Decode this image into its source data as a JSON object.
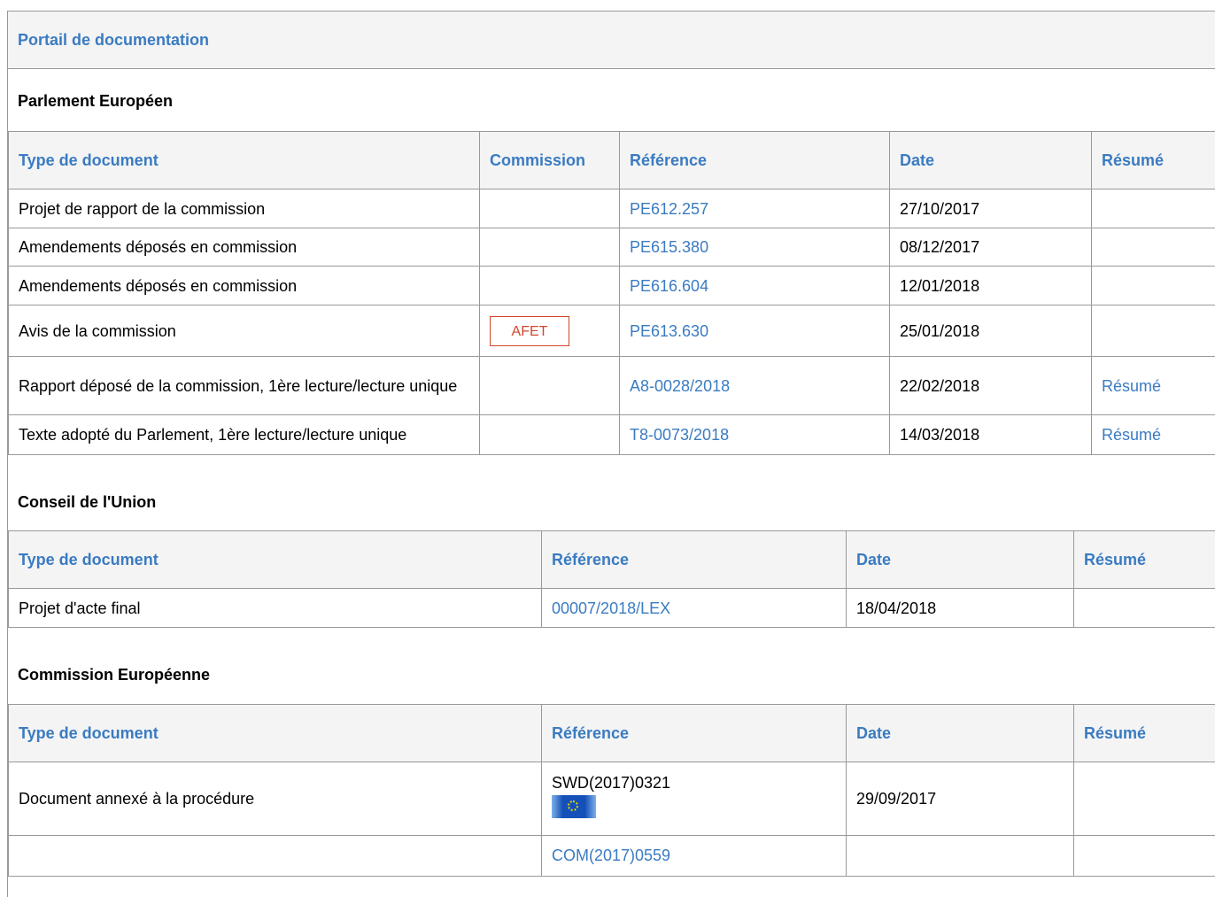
{
  "portal": {
    "title": "Portail de documentation"
  },
  "parlement": {
    "title": "Parlement Européen",
    "headers": {
      "type": "Type de document",
      "commission": "Commission",
      "reference": "Référence",
      "date": "Date",
      "resume": "Résumé"
    },
    "rows": [
      {
        "type": "Projet de rapport de la commission",
        "commission": "",
        "reference": "PE612.257",
        "date": "27/10/2017",
        "resume": ""
      },
      {
        "type": "Amendements déposés en commission",
        "commission": "",
        "reference": "PE615.380",
        "date": "08/12/2017",
        "resume": ""
      },
      {
        "type": "Amendements déposés en commission",
        "commission": "",
        "reference": "PE616.604",
        "date": "12/01/2018",
        "resume": ""
      },
      {
        "type": "Avis de la commission",
        "commission": "AFET",
        "reference": "PE613.630",
        "date": "25/01/2018",
        "resume": ""
      },
      {
        "type": "Rapport déposé de la commission, 1ère lecture/lecture unique",
        "commission": "",
        "reference": "A8-0028/2018",
        "date": "22/02/2018",
        "resume": "Résumé"
      },
      {
        "type": "Texte adopté du Parlement, 1ère lecture/lecture unique",
        "commission": "",
        "reference": "T8-0073/2018",
        "date": "14/03/2018",
        "resume": "Résumé"
      }
    ]
  },
  "conseil": {
    "title": "Conseil de l'Union",
    "headers": {
      "type": "Type de document",
      "reference": "Référence",
      "date": "Date",
      "resume": "Résumé"
    },
    "rows": [
      {
        "type": "Projet d'acte final",
        "reference": "00007/2018/LEX",
        "date": "18/04/2018",
        "resume": ""
      }
    ]
  },
  "commission": {
    "title": "Commission Européenne",
    "headers": {
      "type": "Type de document",
      "reference": "Référence",
      "date": "Date",
      "resume": "Résumé"
    },
    "rows": [
      {
        "type": "Document annexé à la procédure",
        "reference": "SWD(2017)0321",
        "reference_icon": "eu-flag-icon",
        "date": "29/09/2017",
        "resume": ""
      },
      {
        "type": "",
        "reference": "COM(2017)0559",
        "date": "",
        "resume": ""
      }
    ]
  }
}
